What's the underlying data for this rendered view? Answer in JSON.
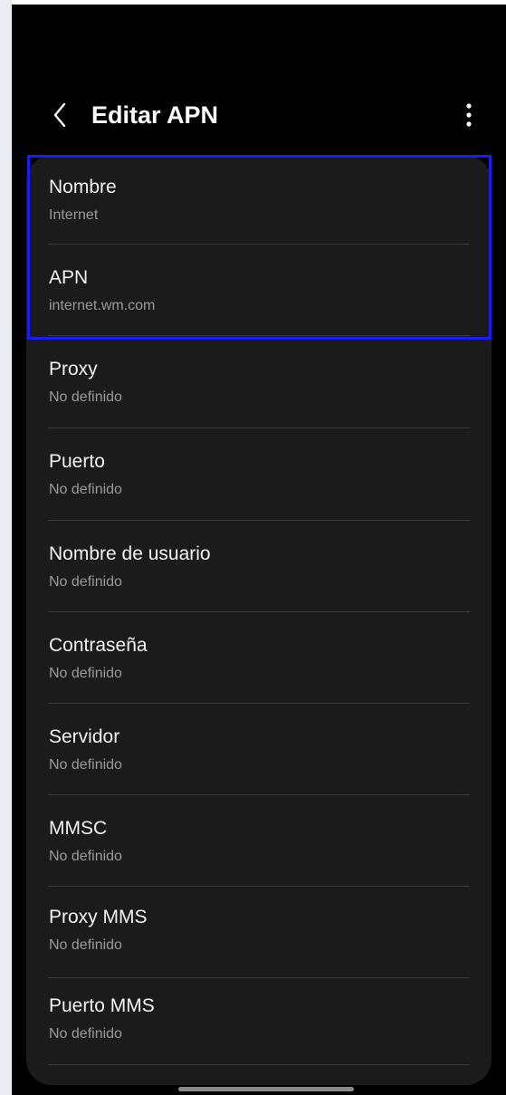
{
  "header": {
    "title": "Editar APN",
    "back_icon": "chevron-left-icon",
    "more_icon": "more-vertical-icon"
  },
  "fields": [
    {
      "label": "Nombre",
      "value": "Internet"
    },
    {
      "label": "APN",
      "value": "internet.wm.com"
    },
    {
      "label": "Proxy",
      "value": "No definido"
    },
    {
      "label": "Puerto",
      "value": "No definido"
    },
    {
      "label": "Nombre de usuario",
      "value": "No definido"
    },
    {
      "label": "Contraseña",
      "value": "No definido"
    },
    {
      "label": "Servidor",
      "value": "No definido"
    },
    {
      "label": "MMSC",
      "value": "No definido"
    },
    {
      "label": "Proxy MMS",
      "value": "No definido"
    },
    {
      "label": "Puerto MMS",
      "value": "No definido"
    }
  ],
  "colors": {
    "background": "#010101",
    "card": "#1b1b1b",
    "label": "#f2f2f2",
    "value": "#9a9a9a",
    "highlight": "#1a1aff"
  }
}
